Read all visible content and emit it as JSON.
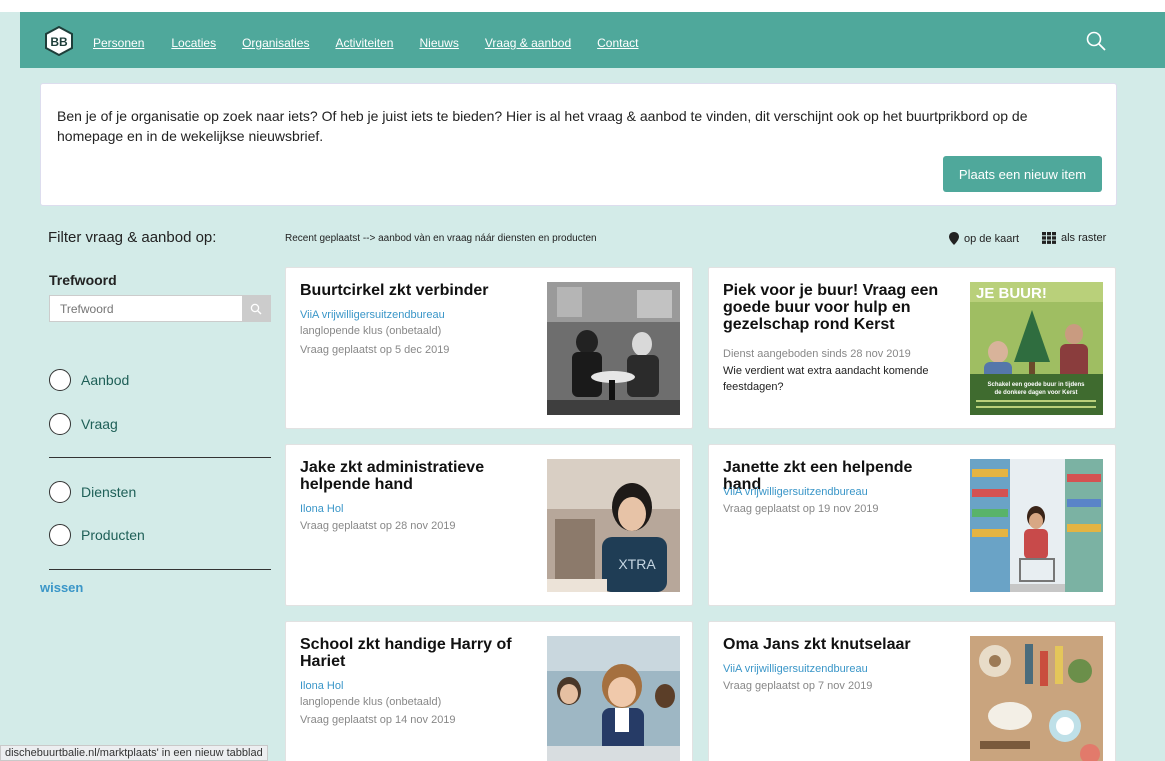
{
  "nav": {
    "logo_text": "BB",
    "items": [
      "Personen",
      "Locaties",
      "Organisaties",
      "Activiteiten",
      "Nieuws",
      "Vraag & aanbod",
      "Contact"
    ]
  },
  "intro": {
    "text": "Ben je of je organisatie op zoek naar iets? Of heb je juist iets te bieden? Hier is al het vraag & aanbod te vinden, dit verschijnt ook op het buurtprikbord op de homepage en in de wekelijkse nieuwsbrief.",
    "button": "Plaats een nieuw item"
  },
  "filter": {
    "title": "Filter vraag & aanbod op:",
    "keyword_label": "Trefwoord",
    "keyword_placeholder": "Trefwoord",
    "options": [
      "Aanbod",
      "Vraag",
      "Diensten",
      "Producten"
    ],
    "clear": "wissen"
  },
  "listing": {
    "recent_text": "Recent geplaatst --> aanbod vàn en vraag náár diensten en producten",
    "map_view": "op de kaart",
    "grid_view": "als raster"
  },
  "cards": [
    {
      "title": "Buurtcirkel zkt verbinder",
      "org": "ViiA vrijwilligersuitzendbureau",
      "meta1": "langlopende klus (onbetaald)",
      "meta2": "Vraag geplaatst op 5 dec 2019"
    },
    {
      "title": "Piek voor je buur! Vraag een goede buur voor hulp en gezelschap rond Kerst",
      "meta1": "Dienst aangeboden sinds 28 nov 2019",
      "desc": "Wie verdient wat extra aandacht komende feestdagen?",
      "poster_title": "JE BUUR!",
      "poster_line1": "Schakel een goede buur in tijdens",
      "poster_line2": "de donkere dagen voor Kerst"
    },
    {
      "title": "Jake zkt administratieve helpende hand",
      "org": "Ilona Hol",
      "meta1": "Vraag geplaatst op 28 nov 2019",
      "shirt_text": "XTRA"
    },
    {
      "title": "Janette zkt een helpende hand",
      "org": "ViiA vrijwilligersuitzendbureau",
      "meta1": "Vraag geplaatst op 19 nov 2019"
    },
    {
      "title": "School zkt handige Harry of Hariet",
      "org": "Ilona Hol",
      "meta1": "langlopende klus (onbetaald)",
      "meta2": "Vraag geplaatst op 14 nov 2019"
    },
    {
      "title": "Oma Jans zkt knutselaar",
      "org": "ViiA vrijwilligersuitzendbureau",
      "meta1": "Vraag geplaatst op 7 nov 2019"
    }
  ],
  "statusbar": {
    "text": "dischebuurtbalie.nl/marktplaats' in een nieuw tabblad"
  }
}
